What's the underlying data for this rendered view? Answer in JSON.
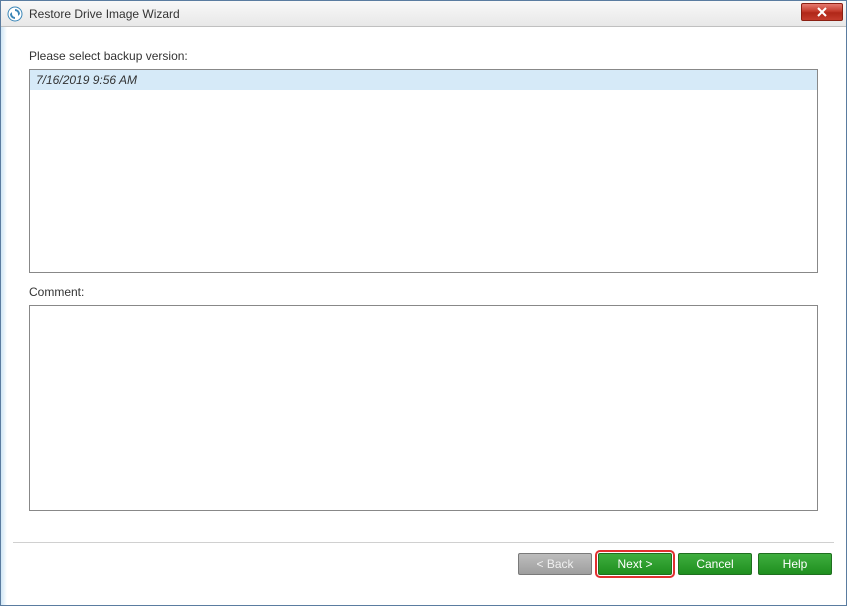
{
  "window": {
    "title": "Restore Drive Image Wizard"
  },
  "labels": {
    "select_version": "Please select backup version:",
    "comment": "Comment:"
  },
  "versions": [
    {
      "text": "7/16/2019 9:56 AM",
      "selected": true
    }
  ],
  "comment_value": "",
  "buttons": {
    "back": "< Back",
    "next": "Next >",
    "cancel": "Cancel",
    "help": "Help"
  }
}
